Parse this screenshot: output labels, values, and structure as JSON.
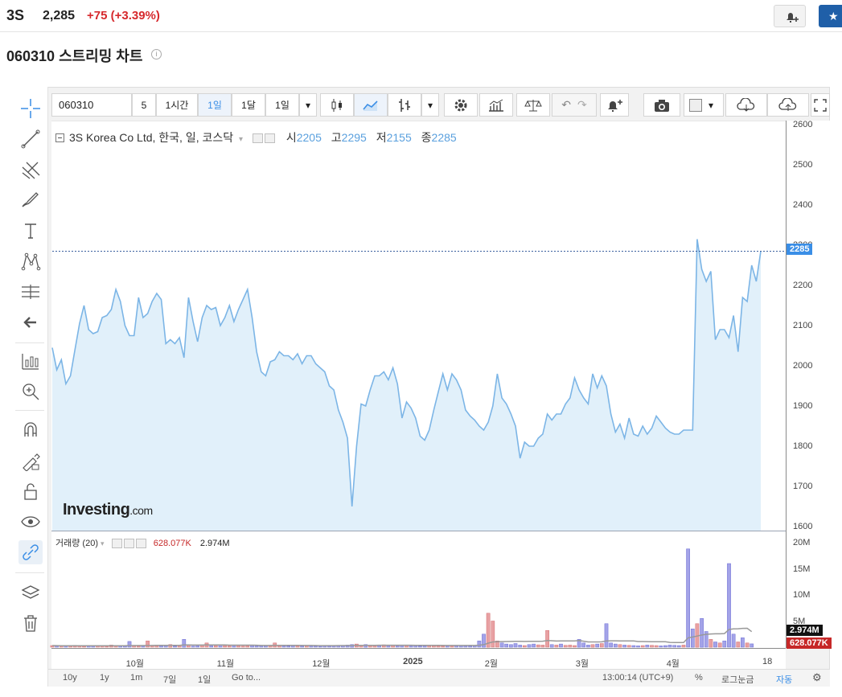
{
  "header": {
    "ticker": "3S",
    "price": "2,285",
    "change": "+75 (+3.39%)",
    "change_color": "#d6292d"
  },
  "title": "060310 스트리밍 차트",
  "toolbar": {
    "symbol": "060310",
    "interval_value": "5",
    "buttons": [
      "1시간",
      "1일",
      "1달",
      "1일"
    ],
    "selected": "1일"
  },
  "legend": {
    "name": "3S Korea Co Ltd, 한국, 일, 코스닥",
    "open_label": "시",
    "open": "2205",
    "high_label": "고",
    "high": "2295",
    "low_label": "저",
    "low": "2155",
    "close_label": "종",
    "close": "2285"
  },
  "volume_legend": {
    "name": "거래량 (20)",
    "value1": "628.077K",
    "value2": "2.974M"
  },
  "logo": {
    "main": "Investing",
    "suffix": ".com"
  },
  "price_axis": {
    "ticks": [
      "2600",
      "2500",
      "2400",
      "2300",
      "2200",
      "2100",
      "2000",
      "1900",
      "1800",
      "1700",
      "1600"
    ],
    "current": "2285"
  },
  "volume_axis": {
    "ticks": [
      "20M",
      "15M",
      "10M",
      "5M"
    ],
    "tag_ma": "2.974M",
    "tag_vol": "628.077K"
  },
  "time_axis": {
    "ticks": [
      "10월",
      "11월",
      "12월",
      "2025",
      "2월",
      "3월",
      "4월",
      "18"
    ]
  },
  "bottom_bar": {
    "ranges": [
      "10y",
      "1y",
      "1m",
      "7일",
      "1일"
    ],
    "goto": "Go to...",
    "clock": "13:00:14 (UTC+9)",
    "percent": "%",
    "log": "로그눈금",
    "auto": "자동"
  },
  "colors": {
    "line": "#7cb5e6",
    "area": "#e1f0fa",
    "vol_up": "#e8a1a3",
    "vol_down": "#a3a3e8",
    "accent": "#3a8ee6",
    "tag_red": "#c62828"
  },
  "chart_data": {
    "type": "area",
    "ylim": [
      1590,
      2610
    ],
    "x": [
      "2024-09-02",
      "2024-09-03",
      "2024-09-04",
      "2024-09-05",
      "2024-09-06",
      "2024-09-09",
      "2024-09-10",
      "2024-09-11",
      "2024-09-12",
      "2024-09-13",
      "2024-09-19",
      "2024-09-20",
      "2024-09-23",
      "2024-09-24",
      "2024-09-25",
      "2024-09-26",
      "2024-09-27",
      "2024-09-30",
      "2024-10-02",
      "2024-10-04",
      "2024-10-07",
      "2024-10-08",
      "2024-10-10",
      "2024-10-11",
      "2024-10-14",
      "2024-10-15",
      "2024-10-16",
      "2024-10-17",
      "2024-10-18",
      "2024-10-21",
      "2024-10-22",
      "2024-10-23",
      "2024-10-24",
      "2024-10-25",
      "2024-10-28",
      "2024-10-29",
      "2024-10-30",
      "2024-10-31",
      "2024-11-01",
      "2024-11-04",
      "2024-11-05",
      "2024-11-06",
      "2024-11-07",
      "2024-11-08",
      "2024-11-11",
      "2024-11-12",
      "2024-11-13",
      "2024-11-14",
      "2024-11-15",
      "2024-11-18",
      "2024-11-19",
      "2024-11-20",
      "2024-11-21",
      "2024-11-22",
      "2024-11-25",
      "2024-11-26",
      "2024-11-27",
      "2024-11-28",
      "2024-11-29",
      "2024-12-02",
      "2024-12-03",
      "2024-12-04",
      "2024-12-05",
      "2024-12-06",
      "2024-12-09",
      "2024-12-10",
      "2024-12-11",
      "2024-12-12",
      "2024-12-13",
      "2024-12-16",
      "2024-12-17",
      "2024-12-18",
      "2024-12-19",
      "2024-12-20",
      "2024-12-23",
      "2024-12-24",
      "2024-12-26",
      "2024-12-27",
      "2024-12-30",
      "2025-01-02",
      "2025-01-03",
      "2025-01-06",
      "2025-01-07",
      "2025-01-08",
      "2025-01-09",
      "2025-01-10",
      "2025-01-13",
      "2025-01-14",
      "2025-01-15",
      "2025-01-16",
      "2025-01-17",
      "2025-01-20",
      "2025-01-21",
      "2025-01-22",
      "2025-01-23",
      "2025-01-24",
      "2025-01-31",
      "2025-02-03",
      "2025-02-04",
      "2025-02-05",
      "2025-02-06",
      "2025-02-07",
      "2025-02-10",
      "2025-02-11",
      "2025-02-12",
      "2025-02-13",
      "2025-02-14",
      "2025-02-17",
      "2025-02-18",
      "2025-02-19",
      "2025-02-20",
      "2025-02-21",
      "2025-02-24",
      "2025-02-25",
      "2025-02-26",
      "2025-02-27",
      "2025-02-28",
      "2025-03-04",
      "2025-03-05",
      "2025-03-06",
      "2025-03-07",
      "2025-03-10",
      "2025-03-11",
      "2025-03-12",
      "2025-03-13",
      "2025-03-14",
      "2025-03-17",
      "2025-03-18",
      "2025-03-19",
      "2025-03-20",
      "2025-03-21",
      "2025-03-24",
      "2025-03-25",
      "2025-03-26",
      "2025-03-27",
      "2025-03-28",
      "2025-03-31",
      "2025-04-01",
      "2025-04-02",
      "2025-04-03",
      "2025-04-04",
      "2025-04-07",
      "2025-04-08",
      "2025-04-09",
      "2025-04-10",
      "2025-04-11",
      "2025-04-14",
      "2025-04-15",
      "2025-04-16",
      "2025-04-17",
      "2025-04-18"
    ],
    "close": [
      2045,
      1990,
      2015,
      1955,
      1975,
      2040,
      2105,
      2150,
      2090,
      2080,
      2085,
      2120,
      2125,
      2140,
      2190,
      2160,
      2100,
      2075,
      2075,
      2170,
      2120,
      2130,
      2160,
      2180,
      2165,
      2055,
      2065,
      2055,
      2070,
      2020,
      2170,
      2110,
      2060,
      2120,
      2150,
      2140,
      2145,
      2100,
      2120,
      2150,
      2110,
      2140,
      2165,
      2190,
      2120,
      2035,
      1985,
      1975,
      2010,
      2015,
      2035,
      2025,
      2025,
      2015,
      2030,
      2005,
      2025,
      2025,
      2005,
      1995,
      1985,
      1950,
      1940,
      1890,
      1860,
      1820,
      1650,
      1800,
      1905,
      1900,
      1940,
      1975,
      1975,
      1985,
      1965,
      1995,
      1955,
      1870,
      1910,
      1895,
      1870,
      1825,
      1815,
      1840,
      1890,
      1935,
      1980,
      1940,
      1980,
      1965,
      1940,
      1890,
      1875,
      1865,
      1850,
      1840,
      1860,
      1900,
      1980,
      1920,
      1905,
      1880,
      1850,
      1770,
      1810,
      1800,
      1800,
      1820,
      1830,
      1880,
      1865,
      1880,
      1880,
      1905,
      1920,
      1970,
      1940,
      1920,
      1905,
      1980,
      1945,
      1975,
      1950,
      1880,
      1835,
      1855,
      1820,
      1870,
      1830,
      1825,
      1850,
      1830,
      1845,
      1875,
      1860,
      1845,
      1835,
      1830,
      1830,
      1840,
      1840,
      1840,
      2315,
      2240,
      2210,
      2235,
      2065,
      2090,
      2090,
      2070,
      2125,
      2035,
      2170,
      2160,
      2250,
      2210,
      2285
    ],
    "volume_ylim": [
      0,
      20000000
    ],
    "volume": [
      300000,
      250000,
      200000,
      220000,
      180000,
      350000,
      200000,
      150000,
      300000,
      180000,
      200000,
      250000,
      150000,
      400000,
      200000,
      300000,
      180000,
      1100000,
      350000,
      200000,
      250000,
      1200000,
      300000,
      400000,
      250000,
      350000,
      500000,
      200000,
      350000,
      1500000,
      400000,
      200000,
      250000,
      400000,
      800000,
      250000,
      300000,
      400000,
      300000,
      250000,
      350000,
      300000,
      200000,
      250000,
      300000,
      200000,
      250000,
      300000,
      350000,
      800000,
      300000,
      250000,
      200000,
      300000,
      250000,
      200000,
      300000,
      250000,
      200000,
      150000,
      300000,
      200000,
      250000,
      300000,
      350000,
      400000,
      500000,
      600000,
      400000,
      500000,
      300000,
      400000,
      350000,
      450000,
      300000,
      350000,
      250000,
      300000,
      350000,
      250000,
      300000,
      200000,
      250000,
      300000,
      350000,
      250000,
      200000,
      300000,
      250000,
      350000,
      300000,
      250000,
      200000,
      300000,
      1200000,
      2500000,
      6500000,
      5000000,
      1200000,
      800000,
      600000,
      500000,
      700000,
      400000,
      300000,
      500000,
      600000,
      450000,
      400000,
      3200000,
      500000,
      400000,
      600000,
      350000,
      400000,
      300000,
      1500000,
      800000,
      400000,
      500000,
      600000,
      700000,
      4500000,
      800000,
      600000,
      500000,
      400000,
      350000,
      300000,
      250000,
      300000,
      400000,
      350000,
      300000,
      250000,
      300000,
      400000,
      350000,
      300000,
      400000,
      18800000,
      3500000,
      4500000,
      5500000,
      3000000,
      1500000,
      1000000,
      800000,
      1200000,
      16000000,
      2500000,
      1000000,
      1800000,
      800000,
      628077
    ],
    "volume_up": [
      true,
      false,
      true,
      false,
      true,
      true,
      true,
      true,
      false,
      false,
      true,
      true,
      true,
      true,
      true,
      false,
      false,
      false,
      true,
      true,
      false,
      true,
      true,
      true,
      false,
      false,
      true,
      false,
      true,
      false,
      true,
      false,
      false,
      true,
      true,
      false,
      true,
      false,
      true,
      true,
      false,
      true,
      true,
      true,
      false,
      false,
      false,
      false,
      true,
      true,
      true,
      false,
      false,
      false,
      true,
      false,
      true,
      false,
      false,
      false,
      false,
      false,
      false,
      false,
      false,
      false,
      false,
      true,
      true,
      false,
      true,
      true,
      false,
      true,
      false,
      true,
      false,
      false,
      true,
      false,
      false,
      false,
      false,
      true,
      true,
      true,
      true,
      false,
      true,
      false,
      false,
      false,
      false,
      false,
      false,
      false,
      true,
      true,
      true,
      false,
      false,
      false,
      false,
      false,
      true,
      false,
      false,
      true,
      true,
      true,
      false,
      true,
      false,
      true,
      true,
      true,
      false,
      false,
      false,
      true,
      false,
      true,
      false,
      false,
      false,
      true,
      false,
      true,
      false,
      false,
      true,
      false,
      true,
      true,
      false,
      false,
      false,
      false,
      false,
      true,
      false,
      false,
      true,
      false,
      false,
      true,
      false,
      true,
      false,
      false,
      false,
      true,
      false,
      true,
      false,
      true,
      false,
      true
    ],
    "volume_ma": [
      300000,
      290000,
      280000,
      280000,
      270000,
      275000,
      270000,
      265000,
      270000,
      265000,
      265000,
      270000,
      265000,
      270000,
      270000,
      275000,
      270000,
      300000,
      305000,
      300000,
      300000,
      330000,
      330000,
      340000,
      340000,
      345000,
      355000,
      350000,
      355000,
      410000,
      410000,
      400000,
      400000,
      405000,
      425000,
      425000,
      425000,
      420000,
      420000,
      380000,
      385000,
      390000,
      385000,
      385000,
      385000,
      370000,
      325000,
      330000,
      330000,
      355000,
      345000,
      345000,
      340000,
      340000,
      335000,
      330000,
      325000,
      320000,
      315000,
      295000,
      290000,
      290000,
      295000,
      300000,
      300000,
      305000,
      320000,
      335000,
      340000,
      355000,
      355000,
      360000,
      365000,
      375000,
      375000,
      375000,
      370000,
      370000,
      370000,
      365000,
      360000,
      350000,
      345000,
      345000,
      345000,
      340000,
      330000,
      330000,
      325000,
      330000,
      330000,
      330000,
      325000,
      325000,
      370000,
      470000,
      770000,
      1000000,
      1040000,
      1060000,
      1075000,
      1085000,
      1105000,
      1105000,
      1100000,
      1110000,
      1125000,
      1130000,
      1135000,
      1275000,
      1235000,
      1175000,
      1180000,
      1185000,
      1185000,
      1185000,
      1255000,
      1140000,
      1000000,
      1000000,
      1000000,
      1015000,
      1205000,
      1210000,
      1220000,
      1200000,
      1200000,
      1190000,
      1185000,
      1080000,
      1070000,
      1065000,
      1040000,
      1040000,
      1040000,
      1035000,
      900000,
      880000,
      870000,
      870000,
      1780000,
      1935000,
      2130000,
      2330000,
      2460000,
      2520000,
      2550000,
      2560000,
      2600000,
      3380000,
      3490000,
      3525000,
      3595000,
      3615000,
      2974000
    ]
  }
}
